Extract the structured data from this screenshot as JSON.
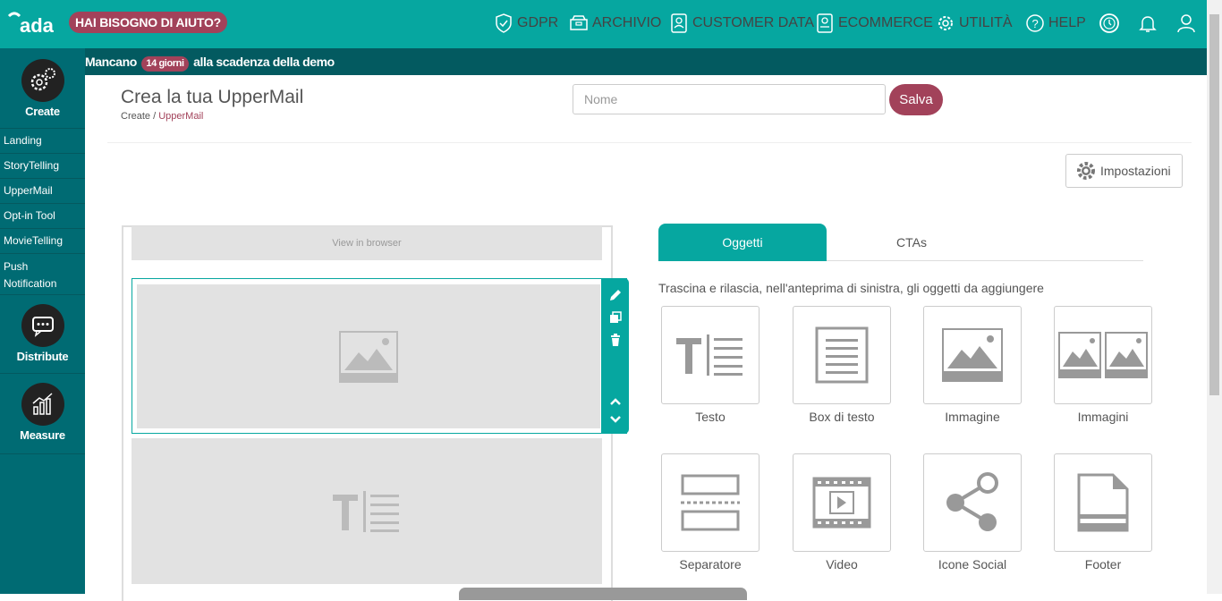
{
  "header": {
    "logo_text": "ada",
    "help_badge": "HAI BISOGNO DI AIUTO?",
    "nav": [
      {
        "label": "GDPR",
        "icon": "shield-check-icon"
      },
      {
        "label": "ARCHIVIO",
        "icon": "archive-icon"
      },
      {
        "label": "CUSTOMER DATA",
        "icon": "customer-data-icon"
      },
      {
        "label": "ECOMMERCE",
        "icon": "ecommerce-icon"
      },
      {
        "label": "UTILITÀ",
        "icon": "gear-icon"
      },
      {
        "label": "HELP",
        "icon": "help-icon"
      }
    ],
    "icon_buttons": [
      "clock-icon",
      "bell-icon",
      "user-icon"
    ]
  },
  "sidebar": {
    "create_label": "Create",
    "distribute_label": "Distribute",
    "measure_label": "Measure",
    "create_items": [
      "Landing",
      "StoryTelling",
      "UpperMail",
      "Opt-in Tool",
      "MovieTelling",
      "Push Notification"
    ]
  },
  "demo_bar": {
    "prefix": "Mancano",
    "days": "14 giorni",
    "suffix": "alla scadenza della demo"
  },
  "page": {
    "title": "Crea la tua UpperMail",
    "breadcrumb_root": "Create",
    "breadcrumb_sep": "/",
    "breadcrumb_current": "UpperMail",
    "name_placeholder": "Nome",
    "save_label": "Salva",
    "settings_label": "Impostazioni"
  },
  "editor": {
    "view_in_browser": "View in browser"
  },
  "panel": {
    "tabs": [
      "Oggetti",
      "CTAs"
    ],
    "active_tab": "Oggetti",
    "hint": "Trascina e rilascia, nell'anteprima di sinistra, gli oggetti da aggiungere",
    "objects": [
      {
        "label": "Testo",
        "icon": "text-icon"
      },
      {
        "label": "Box di testo",
        "icon": "text-box-icon"
      },
      {
        "label": "Immagine",
        "icon": "image-icon"
      },
      {
        "label": "Immagini",
        "icon": "images-icon"
      },
      {
        "label": "Separatore",
        "icon": "separator-icon"
      },
      {
        "label": "Video",
        "icon": "video-icon"
      },
      {
        "label": "Icone Social",
        "icon": "share-icon"
      },
      {
        "label": "Footer",
        "icon": "footer-icon"
      }
    ]
  },
  "colors": {
    "teal": "#06a7a0",
    "dark_teal": "#006b73",
    "accent": "#a2425a"
  }
}
